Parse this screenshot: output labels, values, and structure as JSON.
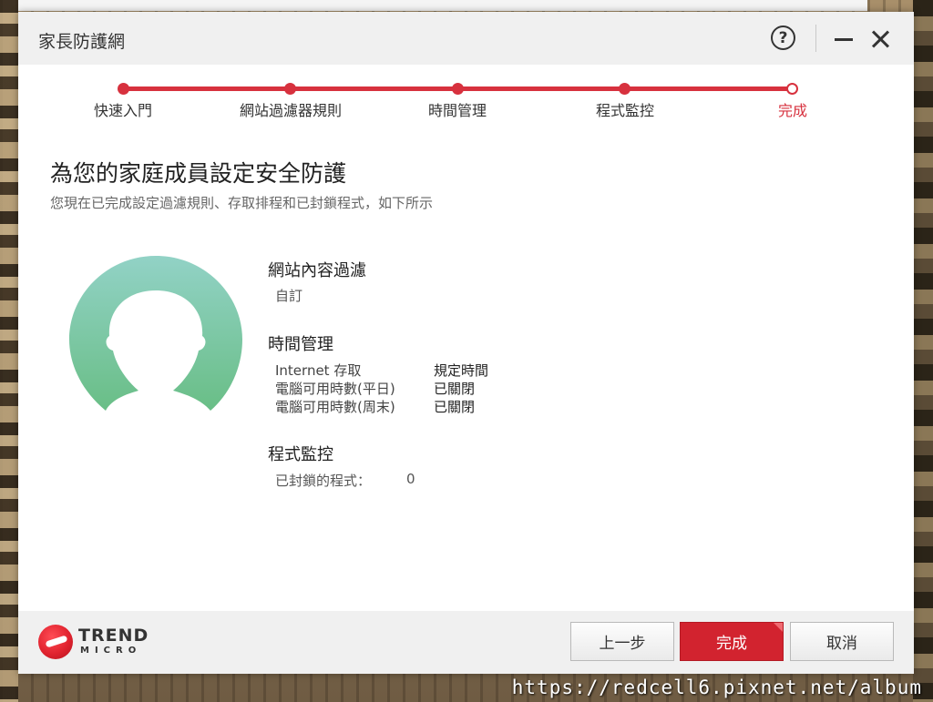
{
  "window": {
    "title": "家長防護網",
    "help_glyph": "?"
  },
  "steps": [
    {
      "label": "快速入門",
      "state": "done"
    },
    {
      "label": "網站過濾器規則",
      "state": "done"
    },
    {
      "label": "時間管理",
      "state": "done"
    },
    {
      "label": "程式監控",
      "state": "done"
    },
    {
      "label": "完成",
      "state": "current"
    }
  ],
  "main": {
    "heading": "為您的家庭成員設定安全防護",
    "subheading": "您現在已完成設定過濾規則、存取排程和已封鎖程式，如下所示"
  },
  "summary": {
    "web_filter": {
      "title": "網站內容過濾",
      "value": "自訂"
    },
    "time_management": {
      "title": "時間管理",
      "rows": [
        {
          "key": "Internet 存取",
          "value": "規定時間"
        },
        {
          "key": "電腦可用時數(平日)",
          "value": "已關閉"
        },
        {
          "key": "電腦可用時數(周末)",
          "value": "已關閉"
        }
      ]
    },
    "program_control": {
      "title": "程式監控",
      "blocked_label": "已封鎖的程式：",
      "blocked_count": "0"
    }
  },
  "footer": {
    "logo_top": "TREND",
    "logo_bottom": "MICRO",
    "back_label": "上一步",
    "finish_label": "完成",
    "cancel_label": "取消"
  },
  "watermark": "https://redcell6.pixnet.net/album",
  "colors": {
    "accent": "#d7313e",
    "avatar_top": "#8fd0c4",
    "avatar_bottom": "#6cc088"
  },
  "icons": [
    "help-icon",
    "minimize-icon",
    "close-icon",
    "user-avatar-icon",
    "trend-micro-logo"
  ]
}
